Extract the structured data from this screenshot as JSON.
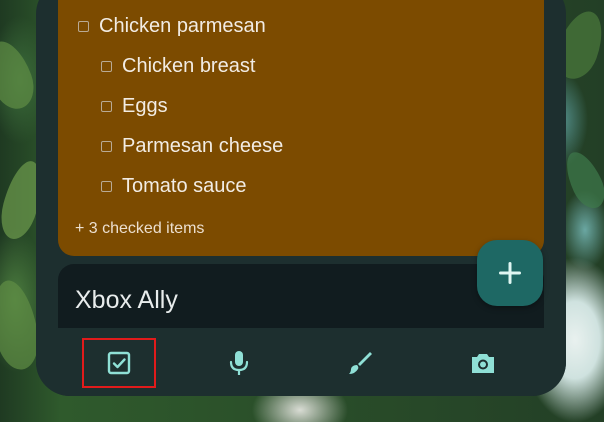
{
  "checklist": {
    "parent": "Chicken parmesan",
    "items": [
      {
        "label": "Chicken breast"
      },
      {
        "label": "Eggs"
      },
      {
        "label": "Parmesan cheese"
      },
      {
        "label": "Tomato sauce"
      }
    ],
    "checked_summary": "+ 3 checked items"
  },
  "next_note": {
    "title": "Xbox Ally"
  },
  "fab": {
    "icon": "plus-icon"
  },
  "bottom_bar": {
    "buttons": [
      {
        "icon": "checkbox-icon",
        "selected": true
      },
      {
        "icon": "microphone-icon",
        "selected": false
      },
      {
        "icon": "brush-icon",
        "selected": false
      },
      {
        "icon": "camera-icon",
        "selected": false
      }
    ]
  },
  "colors": {
    "note_brown": "#7c4b00",
    "card_bg": "#1d2f2f",
    "fab": "#1e6864",
    "icon_accent": "#8fe0d6",
    "highlight": "#e11b1b"
  }
}
